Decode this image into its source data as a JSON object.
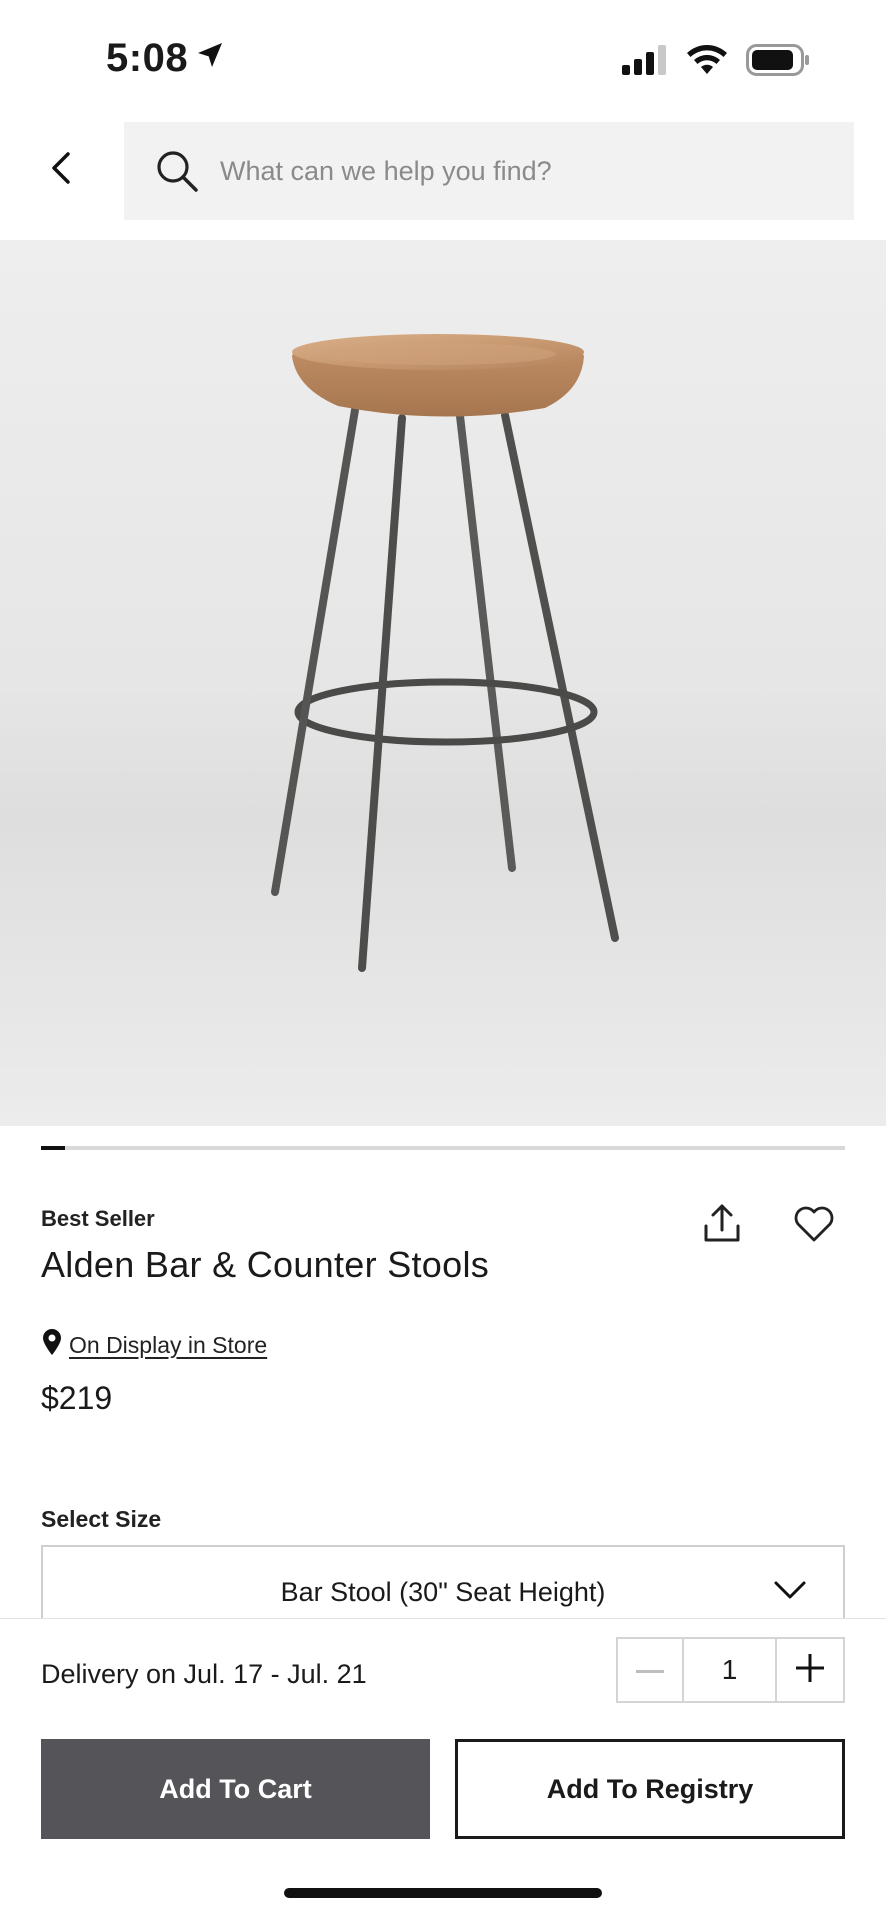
{
  "status_bar": {
    "time": "5:08",
    "icons": [
      "location-arrow-icon",
      "cellular-signal-icon",
      "wifi-icon",
      "battery-icon"
    ]
  },
  "header": {
    "search_placeholder": "What can we help you find?",
    "back_icon": "chevron-left-icon",
    "search_icon": "search-icon"
  },
  "product": {
    "image_alt": "Alden Bar & Counter Stools",
    "carousel_progress": 0.03,
    "badge": "Best Seller",
    "title": "Alden Bar & Counter Stools",
    "store_link": "On Display in Store",
    "price": "$219",
    "size_label": "Select Size",
    "size_value": "Bar Stool (30\" Seat Height)"
  },
  "purchase": {
    "delivery": "Delivery on Jul. 17 - Jul. 21",
    "quantity": "1",
    "add_to_cart": "Add To Cart",
    "add_to_registry": "Add To Registry"
  },
  "colors": {
    "cart_button": "#555459",
    "text": "#1a1a1a",
    "search_bg": "#f2f2f2"
  }
}
